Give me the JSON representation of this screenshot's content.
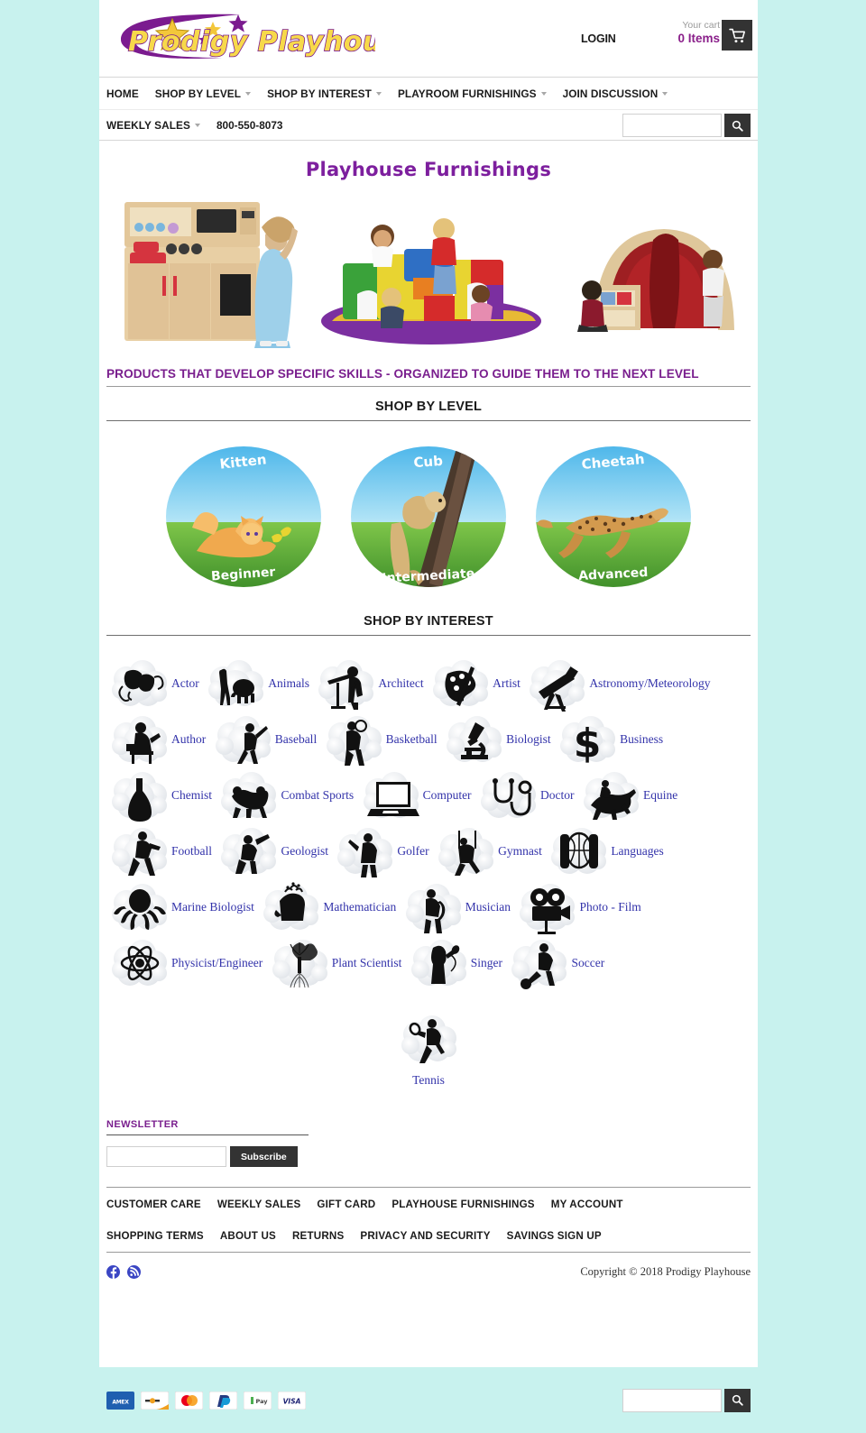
{
  "theme": {
    "page_bg": "#c8f2ee",
    "content_bg": "#ffffff",
    "accent_purple": "#7a1f8e",
    "link_blue": "#3333aa",
    "dark_button": "#333333"
  },
  "header": {
    "logo_text": "Prodigy Playhouse",
    "login_label": "LOGIN",
    "cart_label": "Your cart",
    "cart_count": "0 Items",
    "cart_icon": "shopping-cart-icon"
  },
  "nav": {
    "primary": [
      {
        "label": "HOME",
        "has_caret": false
      },
      {
        "label": "SHOP BY LEVEL",
        "has_caret": true
      },
      {
        "label": "SHOP BY INTEREST",
        "has_caret": true
      },
      {
        "label": "PLAYROOM FURNISHINGS",
        "has_caret": true
      },
      {
        "label": "JOIN DISCUSSION",
        "has_caret": true
      }
    ],
    "secondary": [
      {
        "label": "WEEKLY SALES",
        "has_caret": true
      }
    ],
    "phone": "800-550-8073"
  },
  "search": {
    "value": "",
    "placeholder": "",
    "icon": "search-icon"
  },
  "banner": {
    "title": "Playhouse Furnishings",
    "images": [
      "play-kitchen-with-girl",
      "soft-foam-climber-with-toddlers",
      "red-canopy-playhouse-with-children"
    ]
  },
  "tagline": "PRODUCTS THAT DEVELOP SPECIFIC SKILLS - ORGANIZED TO GUIDE THEM TO THE NEXT LEVEL",
  "shop_by_level": {
    "heading": "SHOP BY LEVEL",
    "levels": [
      {
        "animal": "Kitten",
        "tier": "Beginner",
        "icon": "kitten-photo"
      },
      {
        "animal": "Cub",
        "tier": "Intermediate",
        "icon": "lion-cub-photo"
      },
      {
        "animal": "Cheetah",
        "tier": "Advanced",
        "icon": "cheetah-photo"
      }
    ]
  },
  "shop_by_interest": {
    "heading": "SHOP BY INTEREST",
    "items": [
      {
        "label": "Actor",
        "icon": "theater-masks-icon"
      },
      {
        "label": "Animals",
        "icon": "giraffe-elephant-icon"
      },
      {
        "label": "Architect",
        "icon": "drafting-table-icon"
      },
      {
        "label": "Artist",
        "icon": "paint-palette-icon"
      },
      {
        "label": "Astronomy/Meteorology",
        "icon": "telescope-icon"
      },
      {
        "label": "Author",
        "icon": "writer-at-desk-icon"
      },
      {
        "label": "Baseball",
        "icon": "baseball-batter-icon"
      },
      {
        "label": "Basketball",
        "icon": "basketball-player-icon"
      },
      {
        "label": "Biologist",
        "icon": "microscope-icon"
      },
      {
        "label": "Business",
        "icon": "dollar-sign-icon"
      },
      {
        "label": "Chemist",
        "icon": "flask-icon"
      },
      {
        "label": "Combat Sports",
        "icon": "wrestlers-icon"
      },
      {
        "label": "Computer",
        "icon": "laptop-icon"
      },
      {
        "label": "Doctor",
        "icon": "stethoscope-icon"
      },
      {
        "label": "Equine",
        "icon": "horse-jumper-icon"
      },
      {
        "label": "Football",
        "icon": "football-player-icon"
      },
      {
        "label": "Geologist",
        "icon": "rock-hammer-icon"
      },
      {
        "label": "Golfer",
        "icon": "golfer-icon"
      },
      {
        "label": "Gymnast",
        "icon": "gymnast-rings-icon"
      },
      {
        "label": "Languages",
        "icon": "globe-columns-icon"
      },
      {
        "label": "Marine Biologist",
        "icon": "octopus-icon"
      },
      {
        "label": "Mathematician",
        "icon": "thinking-head-icon"
      },
      {
        "label": "Musician",
        "icon": "saxophone-player-icon"
      },
      {
        "label": "Photo - Film",
        "icon": "movie-camera-icon"
      },
      {
        "label": "Physicist/Engineer",
        "icon": "atom-icon"
      },
      {
        "label": "Plant Scientist",
        "icon": "tree-roots-icon"
      },
      {
        "label": "Singer",
        "icon": "singer-microphone-icon"
      },
      {
        "label": "Soccer",
        "icon": "soccer-player-icon"
      },
      {
        "label": "Tennis",
        "icon": "tennis-player-icon"
      }
    ]
  },
  "newsletter": {
    "title": "NEWSLETTER",
    "input_value": "",
    "input_placeholder": "",
    "subscribe_label": "Subscribe"
  },
  "footer": {
    "row1": [
      "CUSTOMER CARE",
      "WEEKLY SALES",
      "GIFT CARD",
      "PLAYHOUSE FURNISHINGS",
      "MY ACCOUNT"
    ],
    "row2": [
      "SHOPPING TERMS",
      "ABOUT US",
      "RETURNS",
      "PRIVACY AND SECURITY",
      "SAVINGS SIGN UP"
    ],
    "socials": [
      {
        "name": "facebook-icon"
      },
      {
        "name": "rss-icon"
      }
    ],
    "copyright": "Copyright © 2018 Prodigy Playhouse"
  },
  "payments": [
    {
      "name": "amex-icon",
      "label": "AMEX"
    },
    {
      "name": "discover-icon",
      "label": "DISCOVER"
    },
    {
      "name": "mastercard-icon",
      "label": ""
    },
    {
      "name": "paypal-icon",
      "label": "P"
    },
    {
      "name": "google-pay-icon",
      "label": "Pay"
    },
    {
      "name": "visa-icon",
      "label": "VISA"
    }
  ]
}
